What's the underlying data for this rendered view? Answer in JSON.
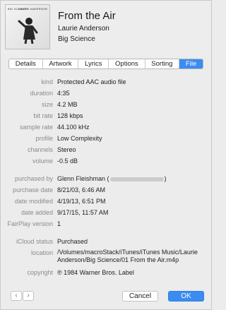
{
  "header": {
    "title": "From the Air",
    "artist": "Laurie Anderson",
    "album": "Big Science",
    "art_text_left": "BIG SCIENCE",
    "art_text_right": "LAURIE ANDERSON"
  },
  "tabs": [
    {
      "label": "Details",
      "active": false
    },
    {
      "label": "Artwork",
      "active": false
    },
    {
      "label": "Lyrics",
      "active": false
    },
    {
      "label": "Options",
      "active": false
    },
    {
      "label": "Sorting",
      "active": false
    },
    {
      "label": "File",
      "active": true
    }
  ],
  "file": {
    "kind": {
      "label": "kind",
      "value": "Protected AAC audio file"
    },
    "duration": {
      "label": "duration",
      "value": "4:35"
    },
    "size": {
      "label": "size",
      "value": "4.2 MB"
    },
    "bit_rate": {
      "label": "bit rate",
      "value": "128 kbps"
    },
    "sample_rate": {
      "label": "sample rate",
      "value": "44.100 kHz"
    },
    "profile": {
      "label": "profile",
      "value": "Low Complexity"
    },
    "channels": {
      "label": "channels",
      "value": "Stereo"
    },
    "volume": {
      "label": "volume",
      "value": "-0.5 dB"
    },
    "purchased_by": {
      "label": "purchased by",
      "value_prefix": "Glenn Fleishman (",
      "value_suffix": ")"
    },
    "purchase_date": {
      "label": "purchase date",
      "value": "8/21/03, 6:46 AM"
    },
    "date_modified": {
      "label": "date modified",
      "value": "4/19/13, 6:51 PM"
    },
    "date_added": {
      "label": "date added",
      "value": "9/17/15, 11:57 AM"
    },
    "fairplay_version": {
      "label": "FairPlay version",
      "value": "1"
    },
    "icloud_status": {
      "label": "iCloud status",
      "value": "Purchased"
    },
    "location": {
      "label": "location",
      "value": "/Volumes/macroStack/iTunes/iTunes Music/Laurie Anderson/Big Science/01 From the Air.m4p"
    },
    "copyright": {
      "label": "copyright",
      "value": "℗ 1984 Warner Bros. Label"
    }
  },
  "footer": {
    "prev_glyph": "‹",
    "next_glyph": "›",
    "cancel_label": "Cancel",
    "ok_label": "OK"
  },
  "colors": {
    "accent": "#3b8cf0",
    "label_gray": "#8b8b8b"
  },
  "icons": [
    "album-art",
    "chevron-left-icon",
    "chevron-right-icon"
  ]
}
